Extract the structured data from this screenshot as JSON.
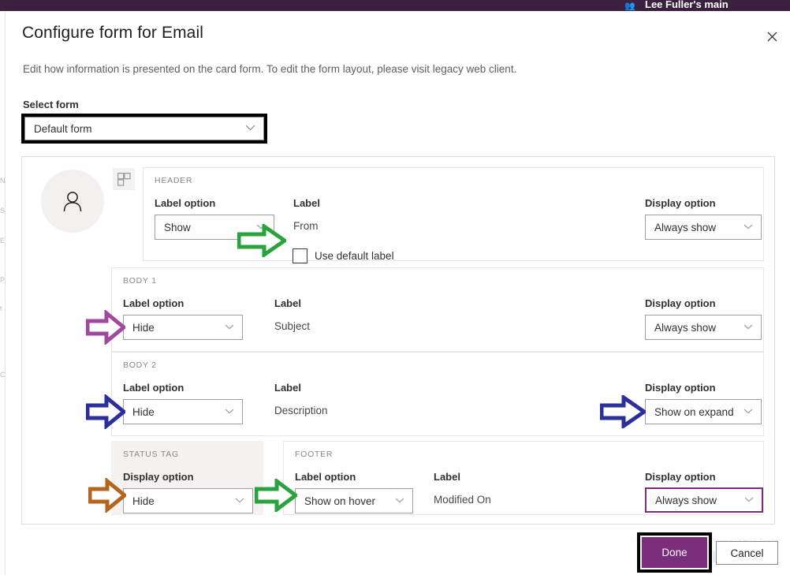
{
  "app_background": {
    "breadcrumb_icon": "people-icon",
    "breadcrumb_text": "Lee Fuller's main",
    "left_ghost_lines": [
      "N",
      "S",
      "E",
      "P",
      "t",
      "C"
    ]
  },
  "dialog": {
    "title": "Configure form for Email",
    "subtitle": "Edit how information is presented on the card form. To edit the form layout, please visit legacy web client.",
    "close_icon": "close-icon",
    "select_form": {
      "label": "Select form",
      "value": "Default form",
      "chevron_icon": "chevron-down-icon",
      "highlighted": true
    },
    "preview": {
      "avatar_icon": "person-icon",
      "layout_icon": "layout-grid-icon",
      "sections": [
        {
          "id": "header",
          "title": "HEADER",
          "label_option_label": "Label option",
          "label_option_value": "Show",
          "label_label": "Label",
          "label_value": "From",
          "checkbox_label": "Use default label",
          "checkbox_checked": false,
          "display_option_label": "Display option",
          "display_option_value": "Always show",
          "display_option_highlighted": false
        },
        {
          "id": "body1",
          "title": "BODY 1",
          "label_option_label": "Label option",
          "label_option_value": "Hide",
          "label_label": "Label",
          "label_value": "Subject",
          "display_option_label": "Display option",
          "display_option_value": "Always show",
          "display_option_highlighted": false
        },
        {
          "id": "body2",
          "title": "BODY 2",
          "label_option_label": "Label option",
          "label_option_value": "Hide",
          "label_label": "Label",
          "label_value": "Description",
          "display_option_label": "Display option",
          "display_option_value": "Show on expand",
          "display_option_highlighted": false
        },
        {
          "id": "status-tag",
          "title": "STATUS TAG",
          "display_option_label": "Display option",
          "display_option_value": "Hide"
        },
        {
          "id": "footer",
          "title": "FOOTER",
          "label_option_label": "Label option",
          "label_option_value": "Show on hover",
          "label_label": "Label",
          "label_value": "Modified On",
          "display_option_label": "Display option",
          "display_option_value": "Always show",
          "display_option_highlighted": true
        }
      ]
    },
    "buttons": {
      "done": "Done",
      "cancel": "Cancel",
      "done_highlighted": true
    }
  },
  "annotations": {
    "arrows": [
      {
        "name": "arrow-header-checkbox",
        "color": "#2aa33f"
      },
      {
        "name": "arrow-body1-label-option",
        "color": "#a0499f"
      },
      {
        "name": "arrow-body2-label-option",
        "color": "#2b2f9e"
      },
      {
        "name": "arrow-body2-display-option",
        "color": "#2b2f9e"
      },
      {
        "name": "arrow-status-tag-display-option",
        "color": "#b5651d"
      },
      {
        "name": "arrow-footer-label-option",
        "color": "#2aa33f"
      }
    ],
    "highlight_boxes": [
      {
        "name": "highlight-select-form",
        "color": "#000000"
      },
      {
        "name": "highlight-footer-display-option",
        "color": "#7b2d7b"
      },
      {
        "name": "highlight-done-button",
        "color": "#000000"
      }
    ]
  },
  "watermark": {
    "text": "innovative logic",
    "logo_text": "LOGIC"
  },
  "colors": {
    "accent": "#7b2d7b",
    "app_bar": "#3b2040",
    "panel_border": "#e1dfdd",
    "muted_text": "#605e5c"
  }
}
